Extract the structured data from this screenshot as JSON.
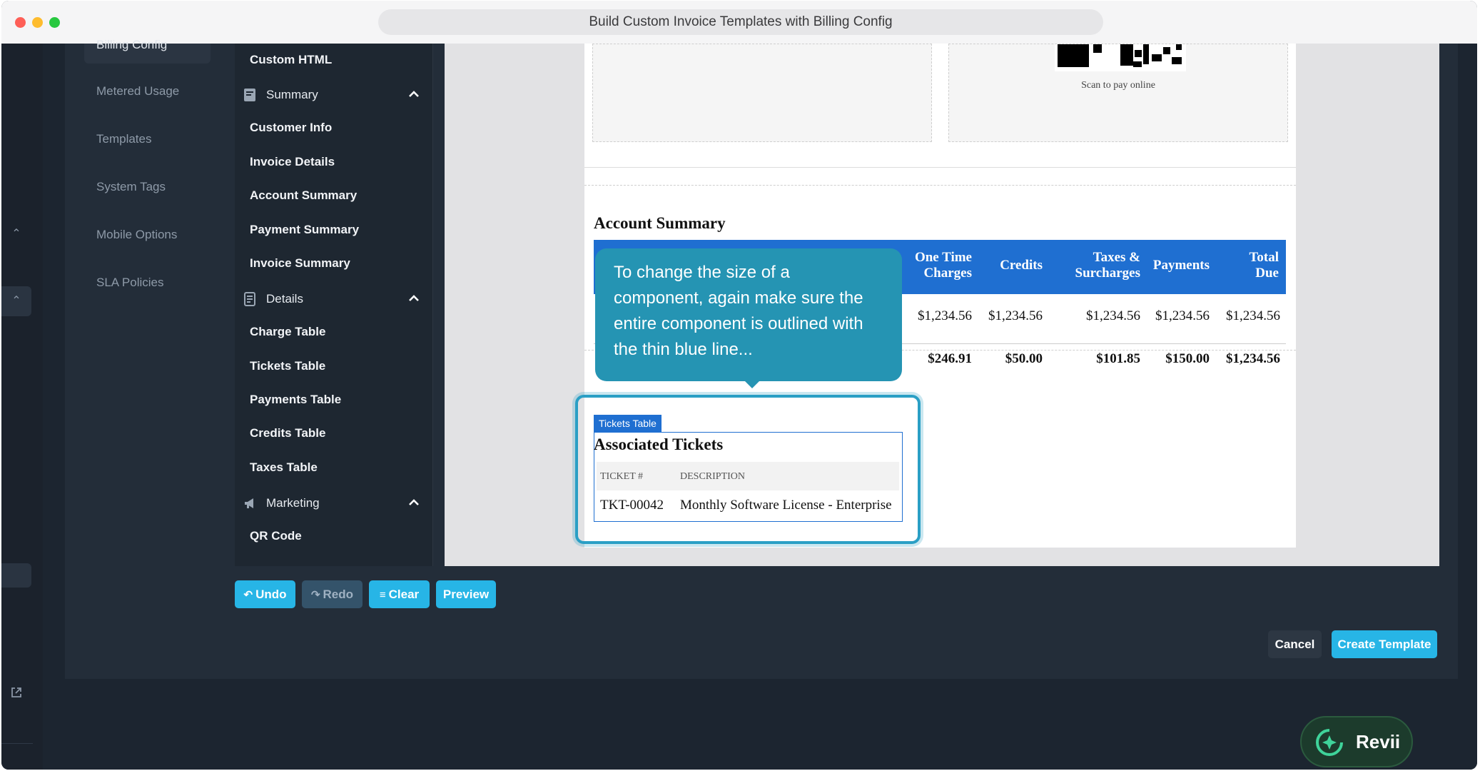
{
  "window": {
    "url_title": "Build Custom Invoice Templates with Billing Config"
  },
  "nav": {
    "active_label": "Billing Config",
    "items": [
      "Metered Usage",
      "Templates",
      "System Tags",
      "Mobile Options",
      "SLA Policies"
    ]
  },
  "components": {
    "custom_html": "Custom HTML",
    "summary_group": "Summary",
    "summary_items": [
      "Customer Info",
      "Invoice Details",
      "Account Summary",
      "Payment Summary",
      "Invoice Summary"
    ],
    "details_group": "Details",
    "details_items": [
      "Charge Table",
      "Tickets Table",
      "Payments Table",
      "Credits Table",
      "Taxes Table"
    ],
    "marketing_group": "Marketing",
    "marketing_items": [
      "QR Code"
    ]
  },
  "preview": {
    "qr_caption": "Scan to pay online",
    "account_summary": {
      "title": "Account Summary",
      "headers": {
        "one_time_1": "One Time",
        "one_time_2": "Charges",
        "credits": "Credits",
        "taxes_1": "Taxes &",
        "taxes_2": "Surcharges",
        "payments": "Payments",
        "total_1": "Total",
        "total_2": "Due"
      },
      "row1": [
        "$1,234.56",
        "$1,234.56",
        "$1,234.56",
        "$1,234.56",
        "$1,234.56"
      ],
      "totals": [
        "$246.91",
        "$50.00",
        "$101.85",
        "$150.00",
        "$1,234.56"
      ]
    },
    "tickets": {
      "tag": "Tickets Table",
      "title": "Associated Tickets",
      "col_ticket": "TICKET #",
      "col_desc": "DESCRIPTION",
      "ticket_id": "TKT-00042",
      "description": "Monthly Software License - Enterprise"
    }
  },
  "tooltip": {
    "text": "To change the size of a component, again make sure the entire component is outlined with the thin blue line..."
  },
  "toolbar": {
    "undo": "Undo",
    "redo": "Redo",
    "clear": "Clear",
    "preview": "Preview"
  },
  "footer": {
    "cancel": "Cancel",
    "create": "Create Template"
  },
  "assistant": {
    "label": "Revii"
  },
  "colors": {
    "accent": "#27b5e6",
    "table_header": "#1f6fd1",
    "tooltip": "#2594b3"
  }
}
